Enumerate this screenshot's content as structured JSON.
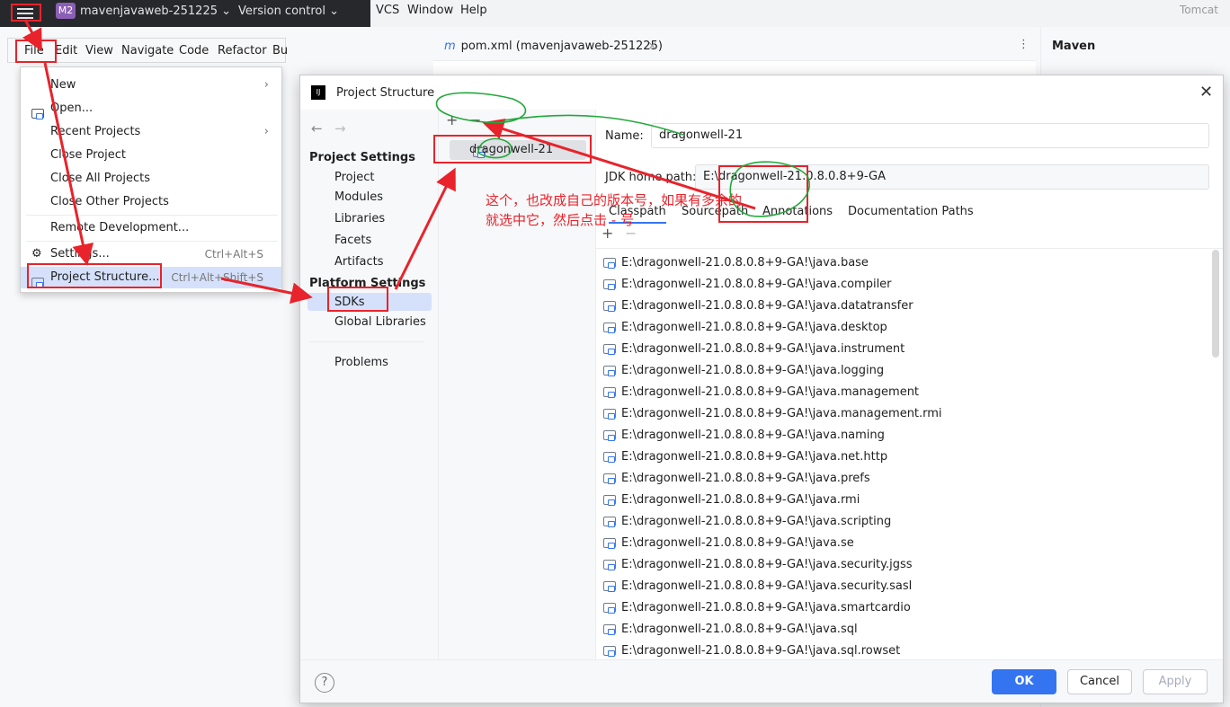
{
  "topbar": {
    "project_badge": "M2",
    "project_name": "mavenjavaweb-251225",
    "version_control": "Version control",
    "menus": [
      "VCS",
      "Window",
      "Help"
    ],
    "tomcat": "Tomcat"
  },
  "editor": {
    "tab_label": "pom.xml (mavenjavaweb-251225)",
    "tab_close": "×",
    "more": "⋮"
  },
  "maven": {
    "title": "Maven"
  },
  "menubar": [
    "File",
    "Edit",
    "View",
    "Navigate",
    "Code",
    "Refactor",
    "Bu"
  ],
  "file_menu": [
    {
      "label": "New",
      "shortcut": "",
      "submenu": true
    },
    {
      "label": "Open...",
      "shortcut": "",
      "submenu": false
    },
    {
      "label": "Recent Projects",
      "shortcut": "",
      "submenu": true
    },
    {
      "label": "Close Project",
      "shortcut": "",
      "submenu": false
    },
    {
      "label": "Close All Projects",
      "shortcut": "",
      "submenu": false
    },
    {
      "label": "Close Other Projects",
      "shortcut": "",
      "submenu": false
    },
    {
      "label": "Remote Development...",
      "shortcut": "",
      "submenu": false
    },
    {
      "label": "Settings...",
      "shortcut": "Ctrl+Alt+S",
      "submenu": false
    },
    {
      "label": "Project Structure...",
      "shortcut": "Ctrl+Alt+Shift+S",
      "submenu": false
    }
  ],
  "dialog": {
    "title": "Project Structure",
    "close": "✕",
    "nav": {
      "project_settings_heading": "Project Settings",
      "project_settings": [
        "Project",
        "Modules",
        "Libraries",
        "Facets",
        "Artifacts"
      ],
      "platform_settings_heading": "Platform Settings",
      "platform_settings": [
        "SDKs",
        "Global Libraries"
      ],
      "problems": "Problems"
    },
    "sdk_list": {
      "add": "+",
      "remove": "−",
      "items": [
        "dragonwell-21"
      ]
    },
    "name_label": "Name:",
    "name_value": "dragonwell-21",
    "jdk_label": "JDK home path:",
    "jdk_value": "E:\\dragonwell-21.0.8.0.8+9-GA",
    "tabs": [
      "Classpath",
      "Sourcepath",
      "Annotations",
      "Documentation Paths"
    ],
    "classpath_add": "+",
    "classpath_remove": "−",
    "classpath": [
      "E:\\dragonwell-21.0.8.0.8+9-GA!\\java.base",
      "E:\\dragonwell-21.0.8.0.8+9-GA!\\java.compiler",
      "E:\\dragonwell-21.0.8.0.8+9-GA!\\java.datatransfer",
      "E:\\dragonwell-21.0.8.0.8+9-GA!\\java.desktop",
      "E:\\dragonwell-21.0.8.0.8+9-GA!\\java.instrument",
      "E:\\dragonwell-21.0.8.0.8+9-GA!\\java.logging",
      "E:\\dragonwell-21.0.8.0.8+9-GA!\\java.management",
      "E:\\dragonwell-21.0.8.0.8+9-GA!\\java.management.rmi",
      "E:\\dragonwell-21.0.8.0.8+9-GA!\\java.naming",
      "E:\\dragonwell-21.0.8.0.8+9-GA!\\java.net.http",
      "E:\\dragonwell-21.0.8.0.8+9-GA!\\java.prefs",
      "E:\\dragonwell-21.0.8.0.8+9-GA!\\java.rmi",
      "E:\\dragonwell-21.0.8.0.8+9-GA!\\java.scripting",
      "E:\\dragonwell-21.0.8.0.8+9-GA!\\java.se",
      "E:\\dragonwell-21.0.8.0.8+9-GA!\\java.security.jgss",
      "E:\\dragonwell-21.0.8.0.8+9-GA!\\java.security.sasl",
      "E:\\dragonwell-21.0.8.0.8+9-GA!\\java.smartcardio",
      "E:\\dragonwell-21.0.8.0.8+9-GA!\\java.sql",
      "E:\\dragonwell-21.0.8.0.8+9-GA!\\java.sql.rowset"
    ],
    "help": "?",
    "buttons": {
      "ok": "OK",
      "cancel": "Cancel",
      "apply": "Apply"
    }
  },
  "annotation": {
    "line1": "这个，也改成自己的版本号，如果有多余的",
    "line2": "就选中它，然后点击 - 号",
    "color": "#e8232b",
    "circle_color": "#22a83a"
  }
}
